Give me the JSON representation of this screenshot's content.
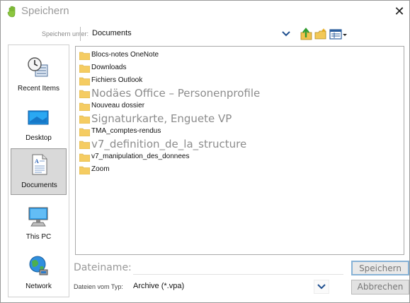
{
  "window": {
    "title": "Speichern"
  },
  "toolbar": {
    "save_in_label": "Speichern unter:",
    "save_in_value": "Documents"
  },
  "places": [
    {
      "label": "Recent Items",
      "icon": "recent-items-icon"
    },
    {
      "label": "Desktop",
      "icon": "desktop-icon"
    },
    {
      "label": "Documents",
      "icon": "documents-icon",
      "selected": true
    },
    {
      "label": "This PC",
      "icon": "computer-icon"
    },
    {
      "label": "Network",
      "icon": "network-icon"
    }
  ],
  "files": [
    {
      "name": "Blocs-notes OneNote"
    },
    {
      "name": "Downloads"
    },
    {
      "name": "Fichiers Outlook"
    },
    {
      "name": "Nodäes Office – Personenprofile"
    },
    {
      "name": "Nouveau dossier"
    },
    {
      "name": "Signaturkarte, Enguete VP"
    },
    {
      "name": "TMA_comptes-rendus"
    },
    {
      "name": "v7_definition_de_la_structure"
    },
    {
      "name": "v7_manipulation_des_donnees"
    },
    {
      "name": "Zoom"
    }
  ],
  "form": {
    "filename_label": "Dateiname:",
    "filename_value": "",
    "filetype_label": "Dateien vom Typ:",
    "filetype_value": "Archive (*.vpa)"
  },
  "buttons": {
    "save": "Speichern",
    "cancel": "Abbrechen"
  },
  "colors": {
    "accent": "#86b2d6",
    "folder": "#f5cc62",
    "selected_place": "#d9d9d9"
  }
}
